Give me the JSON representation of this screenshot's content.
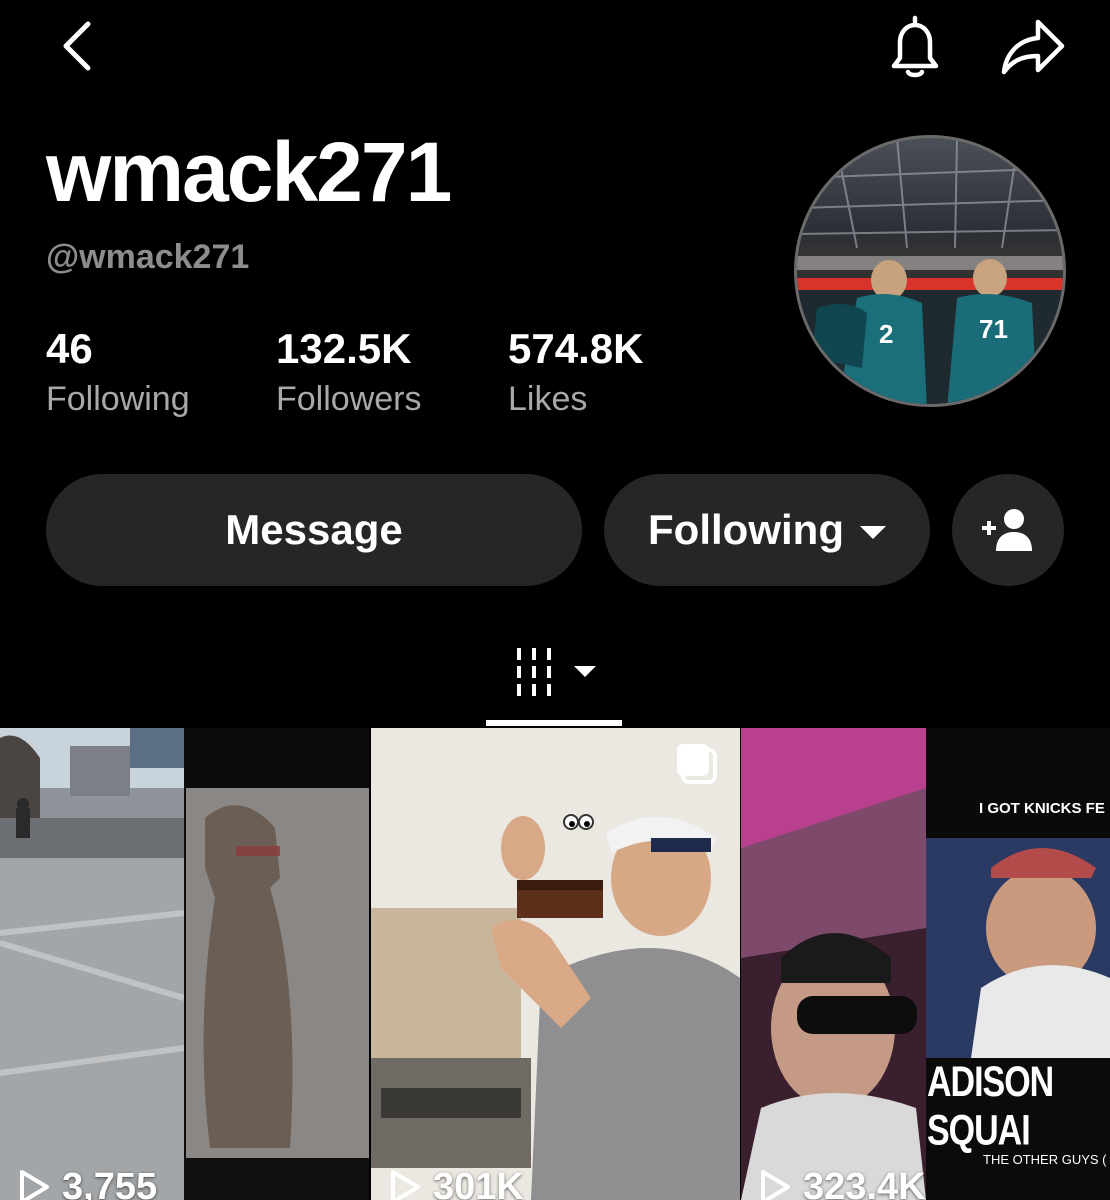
{
  "profile": {
    "display_name": "wmack271",
    "username": "@wmack271",
    "stats": {
      "following_value": "46",
      "following_label": "Following",
      "followers_value": "132.5K",
      "followers_label": "Followers",
      "likes_value": "574.8K",
      "likes_label": "Likes"
    }
  },
  "actions": {
    "message_label": "Message",
    "following_label": "Following"
  },
  "icons": {
    "back": "chevron-left-icon",
    "notifications": "bell-icon",
    "share": "share-arrow-icon",
    "add_friend": "add-user-icon",
    "videos_tab": "grid-bars-icon",
    "multi_image": "stacked-photos-icon",
    "play": "play-outline-icon"
  },
  "videos": [
    {
      "views": "3,755"
    },
    {
      "views": "301K"
    },
    {
      "views": "323.4K",
      "caption_top": "I GOT KNICKS FE",
      "caption_mid": "ADISON SQUAI",
      "caption_bottom": "THE OTHER GUYS ("
    }
  ],
  "colors": {
    "background": "#000000",
    "button": "#262626",
    "secondary_text": "#a9a9a9",
    "username_text": "#8d8d8d"
  }
}
